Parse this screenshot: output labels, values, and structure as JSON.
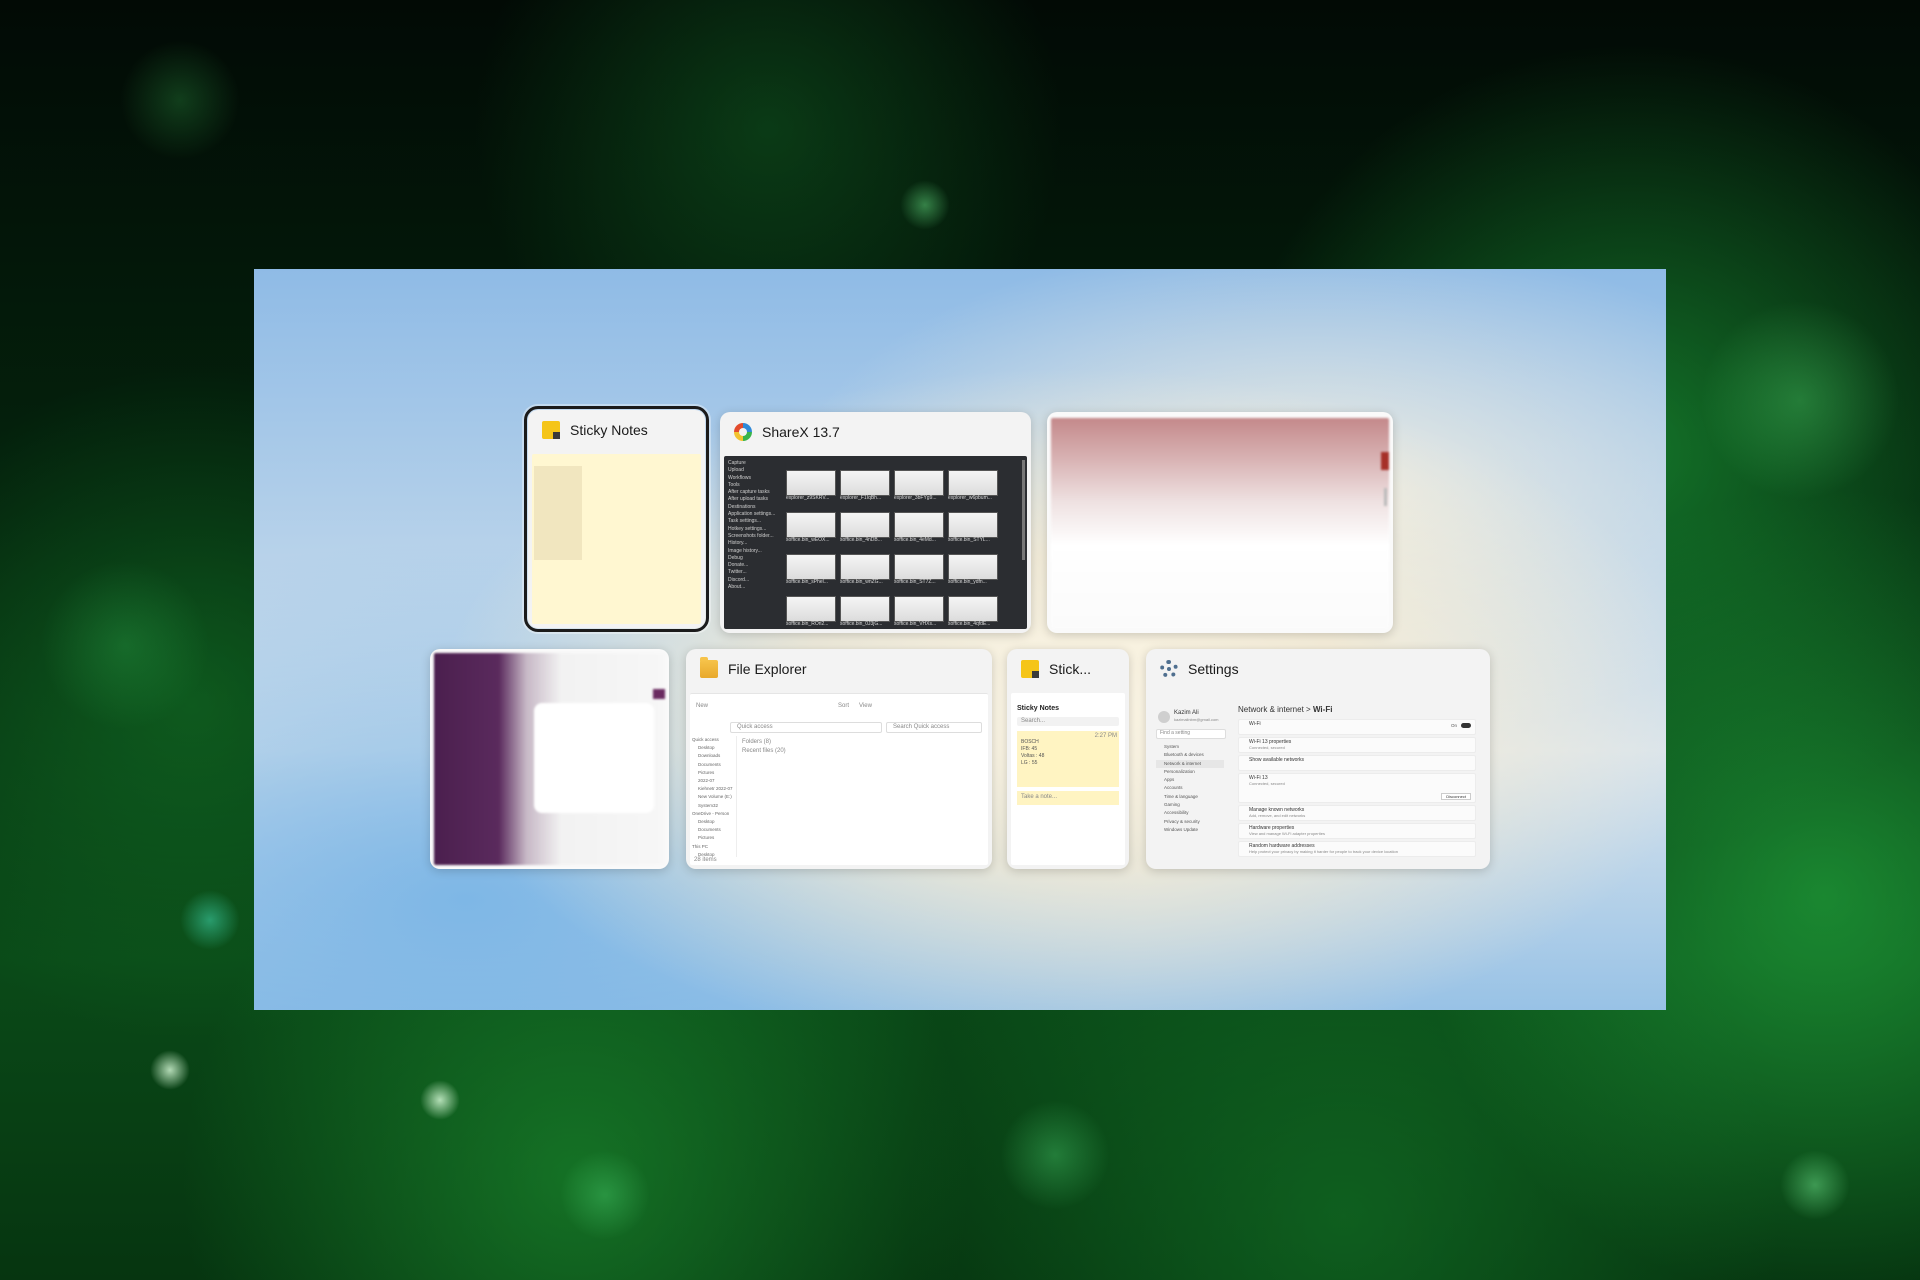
{
  "task_switcher": {
    "windows": [
      {
        "title": "Sticky Notes",
        "icon": "sticky-notes-icon",
        "selected": true
      },
      {
        "title": "ShareX 13.7",
        "icon": "sharex-icon"
      },
      {
        "title": "",
        "icon": ""
      },
      {
        "title": "",
        "icon": ""
      },
      {
        "title": "File Explorer",
        "icon": "folder-icon"
      },
      {
        "title": "Stick...",
        "icon": "sticky-notes-icon"
      },
      {
        "title": "Settings",
        "icon": "gear-icon"
      }
    ]
  },
  "sharex": {
    "sidebar": [
      "Capture",
      "Upload",
      "Workflows",
      "Tools",
      "After capture tasks",
      "After upload tasks",
      "Destinations",
      "Application settings...",
      "Task settings...",
      "Hotkey settings...",
      "Screenshots folder...",
      "History...",
      "Image history...",
      "Debug",
      "Donate...",
      "Twitter...",
      "Discord...",
      "About..."
    ],
    "thumb_labels": [
      "explorer_z9SKRV...",
      "explorer_F1IqBh...",
      "explorer_3bFYg9...",
      "explorer_w6pbum...",
      "soffice.bin_wEOX...",
      "soffice.bin_4nDB...",
      "soffice.bin_4eMd...",
      "soffice.bin_STYL...",
      "soffice.bin_sPhel...",
      "soffice.bin_wnZG...",
      "soffice.bin_ST7Z...",
      "soffice.bin_ydfn...",
      "soffice.bin_ROri2...",
      "soffice.bin_0J3jG...",
      "soffice.bin_VHXs...",
      "soffice.bin_4qfdE..."
    ]
  },
  "explorer": {
    "breadcrumb": "Quick access",
    "search": "Search Quick access",
    "toolbar": [
      "New",
      "Sort",
      "View"
    ],
    "sections": [
      "Folders (8)",
      "Recent files (20)"
    ],
    "nav": [
      "Quick access",
      "Desktop",
      "Downloads",
      "Documents",
      "Pictures",
      "2022-07",
      "Kiehnetr 2022-07",
      "New Volume (E:)",
      "System32",
      "OneDrive - Person",
      "Desktop",
      "Documents",
      "Pictures",
      "This PC",
      "Desktop"
    ],
    "status": "28 items"
  },
  "sticky_small": {
    "heading": "Sticky Notes",
    "search": "Search...",
    "note_lines": [
      "BOSCH",
      "IFB: 45",
      "Voltas : 48",
      "LG : 55"
    ],
    "note_time": "2:27 PM",
    "note2": "Take a note..."
  },
  "settings": {
    "app": "Settings",
    "user_name": "Kazim Ali",
    "user_email": "kazimalinbm@gmail.com",
    "find": "Find a setting",
    "breadcrumb_parent": "Network & internet",
    "breadcrumb_sep": ">",
    "breadcrumb_current": "Wi-Fi",
    "nav": [
      "System",
      "Bluetooth & devices",
      "Network & internet",
      "Personalization",
      "Apps",
      "Accounts",
      "Time & language",
      "Gaming",
      "Accessibility",
      "Privacy & security",
      "Windows Update"
    ],
    "rows": [
      {
        "label": "Wi-Fi",
        "value": "On"
      },
      {
        "label": "Wi-Fi 13 properties",
        "sub": "Connected, secured"
      },
      {
        "label": "Show available networks",
        "sub": ""
      },
      {
        "label": "Wi-Fi 13",
        "sub": "Connected, secured"
      },
      {
        "label": "Manage known networks",
        "sub": "Add, remove, and edit networks"
      },
      {
        "label": "Hardware properties",
        "sub": "View and manage Wi-Fi adapter properties"
      },
      {
        "label": "Random hardware addresses",
        "sub": "Help protect your privacy by making it harder for people to track your device location"
      }
    ],
    "disconnect": "Disconnect"
  }
}
